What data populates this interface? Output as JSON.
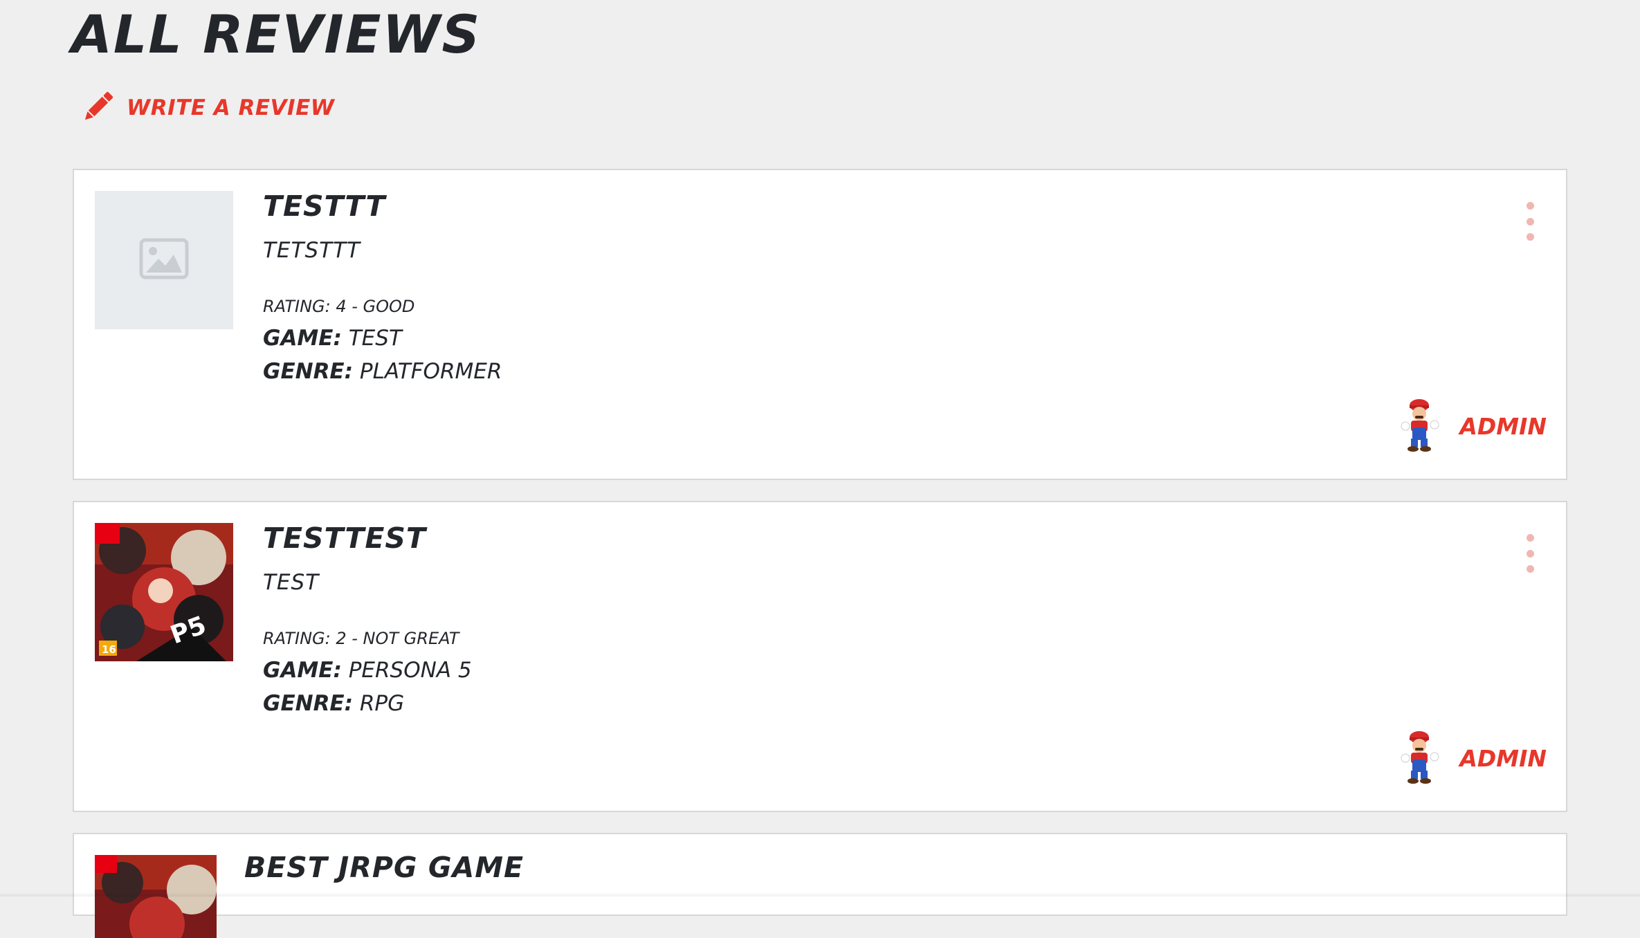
{
  "page": {
    "title": "All Reviews",
    "write_review_label": "Write a review"
  },
  "colors": {
    "accent": "#e8372a",
    "text": "#23262b",
    "background": "#efefef",
    "card": "#ffffff",
    "placeholder": "#e9ecef"
  },
  "reviews": [
    {
      "title": "TESTTT",
      "body": "TETSTTT",
      "rating": "Rating: 4 - Good",
      "game_key": "Game:",
      "game": "Test",
      "genre_key": "Genre:",
      "genre": "Platformer",
      "author": "ADMIN",
      "image": "image-placeholder-icon"
    },
    {
      "title": "TESTTEST",
      "body": "TEST",
      "rating": "Rating: 2 - Not great",
      "game_key": "Game:",
      "game": "Persona 5",
      "genre_key": "Genre:",
      "genre": "RPG",
      "author": "ADMIN",
      "image": "game-cover-art"
    },
    {
      "title": "Best JRPG Game",
      "image": "game-cover-art"
    }
  ]
}
